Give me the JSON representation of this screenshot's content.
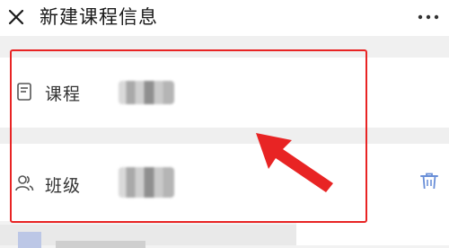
{
  "header": {
    "title": "新建课程信息",
    "close_icon": "close-icon",
    "more_icon": "more-icon"
  },
  "form": {
    "course": {
      "label": "课程",
      "icon": "document-icon"
    },
    "class": {
      "label": "班级",
      "icon": "people-icon"
    }
  },
  "actions": {
    "delete_icon": "trash-icon"
  },
  "colors": {
    "highlight": "#e82424",
    "trash": "#6a8fd8",
    "text": "#333333"
  }
}
